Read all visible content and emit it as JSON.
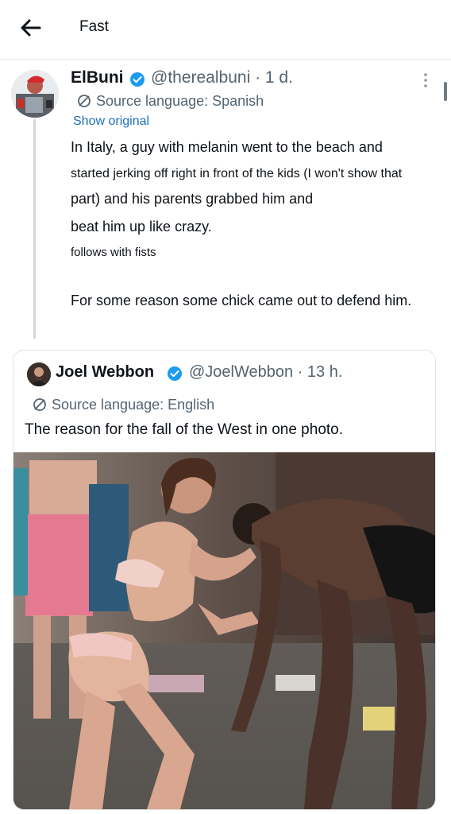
{
  "header": {
    "title": "Fast"
  },
  "post": {
    "author_name": "ElBuni",
    "handle": "@therealbuni",
    "time": "1 d.",
    "source_language": "Source language: Spanish",
    "show_original": "Show original",
    "text_lines": [
      "In Italy, a guy with melanin went to the beach and",
      "started jerking off right in front of the kids (I won't show that",
      "part) and his parents grabbed him and",
      "beat him up like crazy.",
      "follows with fists",
      "For some reason some chick came out to defend him."
    ]
  },
  "quote": {
    "author_name": "Joel Webbon",
    "handle": "@JoelWebbon",
    "time": "13 h.",
    "source_language": "Source language: English",
    "text": "The reason for the fall of the West in one photo."
  },
  "colors": {
    "verified": "#1d9bf0",
    "link": "#1d6fb8",
    "secondary_text": "#536471"
  },
  "icons": [
    "back-arrow-icon",
    "verified-badge-icon",
    "more-vertical-icon",
    "translate-icon"
  ]
}
